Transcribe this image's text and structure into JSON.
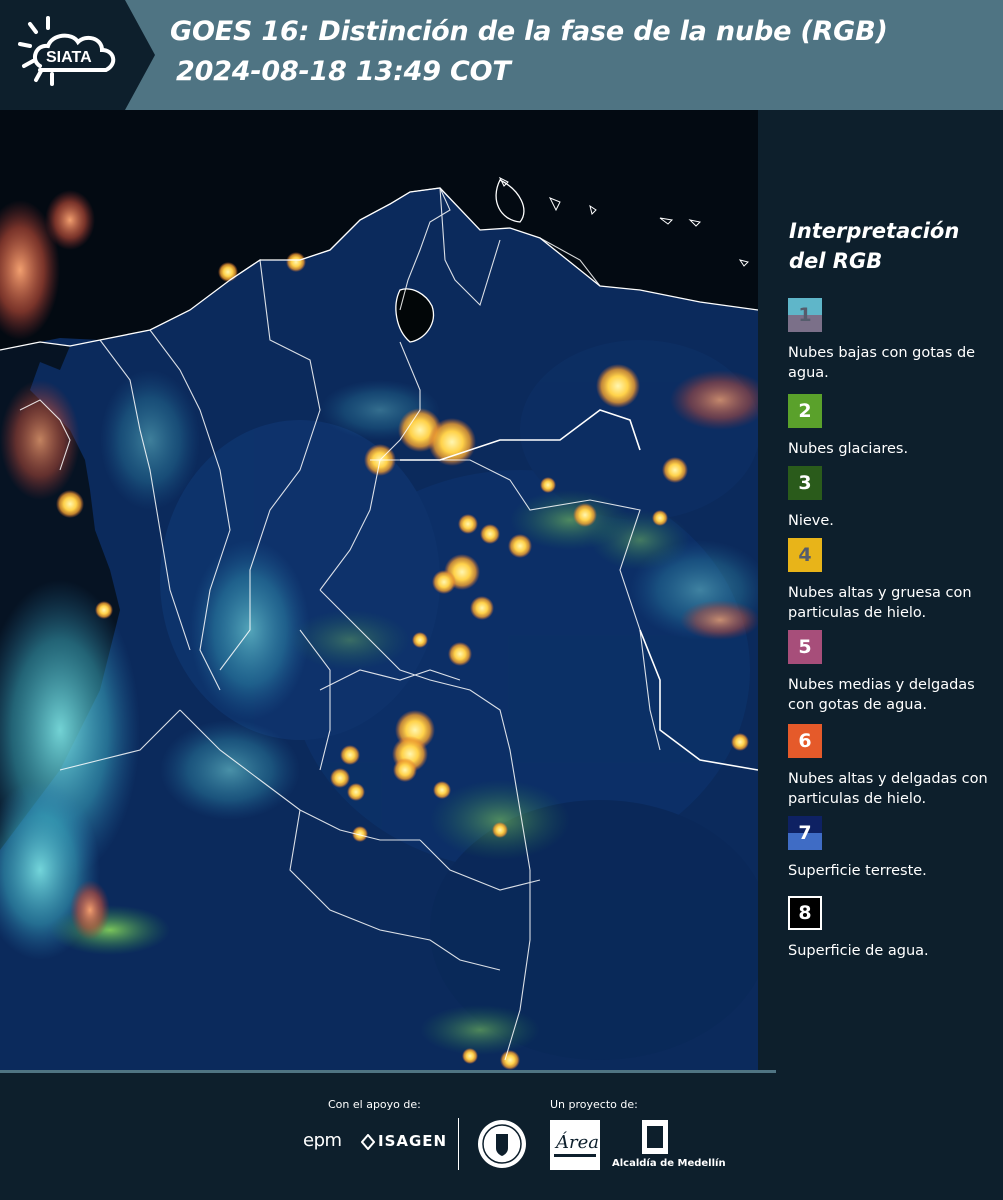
{
  "header": {
    "logo_text": "SIATA",
    "title_line1": "GOES 16: Distinción de la fase de la nube (RGB)",
    "title_line2": "2024-08-18 13:49 COT"
  },
  "legend": {
    "title": "Interpretación del RGB",
    "items": [
      {
        "number": "1",
        "label": "Nubes bajas con gotas de agua.",
        "colors": [
          "#5fb6c9",
          "#7b7089"
        ]
      },
      {
        "number": "2",
        "label": "Nubes glaciares.",
        "colors": [
          "#5aa12b"
        ]
      },
      {
        "number": "3",
        "label": "Nieve.",
        "colors": [
          "#2a5b1b"
        ]
      },
      {
        "number": "4",
        "label": "Nubes altas y gruesa con particulas de hielo.",
        "colors": [
          "#e8b419"
        ]
      },
      {
        "number": "5",
        "label": "Nubes medias y delgadas con gotas de agua.",
        "colors": [
          "#a74e7a"
        ]
      },
      {
        "number": "6",
        "label": "Nubes altas y delgadas con particulas de hielo.",
        "colors": [
          "#e55a2a"
        ]
      },
      {
        "number": "7",
        "label": "Superficie terreste.",
        "colors": [
          "#0e2163",
          "#3f6cc5"
        ]
      },
      {
        "number": "8",
        "label": "Superficie de agua.",
        "colors": [
          "#000000"
        ]
      }
    ]
  },
  "footer": {
    "support_label": "Con el apoyo de:",
    "project_label": "Un proyecto de:",
    "sponsor_epm": "epm",
    "sponsor_isagen": "ISAGEN",
    "sponsor_area": "Área Metropolitana",
    "sponsor_alcaldia": "Alcaldía de Medellín"
  },
  "colors": {
    "header_bg": "#4f7483",
    "panel_bg": "#0d1f2c",
    "land": "#0b2a5c",
    "water": "#020608",
    "cloud_high": "#ffd24a",
    "cloud_low": "#5fd6d8",
    "border_line": "#ffffff"
  }
}
